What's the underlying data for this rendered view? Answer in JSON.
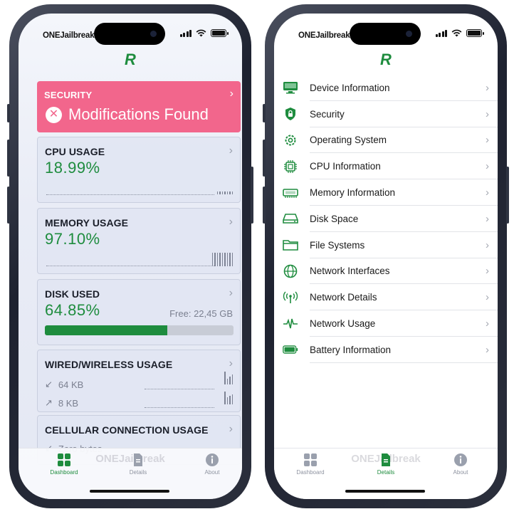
{
  "status_bar": {
    "carrier": "ONEJailbreak"
  },
  "logo": "R",
  "dashboard": {
    "security": {
      "title": "SECURITY",
      "message": "Modifications Found",
      "x_glyph": "✕"
    },
    "cpu": {
      "title": "CPU USAGE",
      "value": "18.99%"
    },
    "memory": {
      "title": "MEMORY USAGE",
      "value": "97.10%"
    },
    "disk": {
      "title": "DISK USED",
      "value": "64.85%",
      "free": "Free: 22,45 GB",
      "used_fraction": 0.6485
    },
    "network": {
      "title": "WIRED/WIRELESS USAGE",
      "download": "64 KB",
      "upload": "8 KB"
    },
    "cellular": {
      "title": "CELLULAR CONNECTION USAGE",
      "download": "Zero bytes"
    }
  },
  "details": {
    "items": [
      {
        "label": "Device Information",
        "icon": "monitor-icon"
      },
      {
        "label": "Security",
        "icon": "lock-shield-icon"
      },
      {
        "label": "Operating System",
        "icon": "gear-icon"
      },
      {
        "label": "CPU Information",
        "icon": "cpu-icon"
      },
      {
        "label": "Memory Information",
        "icon": "memory-icon"
      },
      {
        "label": "Disk Space",
        "icon": "disk-icon"
      },
      {
        "label": "File Systems",
        "icon": "folder-icon"
      },
      {
        "label": "Network Interfaces",
        "icon": "globe-icon"
      },
      {
        "label": "Network Details",
        "icon": "antenna-icon"
      },
      {
        "label": "Network Usage",
        "icon": "waveform-icon"
      },
      {
        "label": "Battery Information",
        "icon": "battery-icon"
      }
    ]
  },
  "tabbar": {
    "watermark": "ONEJailbreak",
    "tabs": [
      {
        "label": "Dashboard"
      },
      {
        "label": "Details"
      },
      {
        "label": "About"
      }
    ]
  },
  "colors": {
    "accent": "#1e8c3e",
    "security_alert": "#f2668c"
  }
}
